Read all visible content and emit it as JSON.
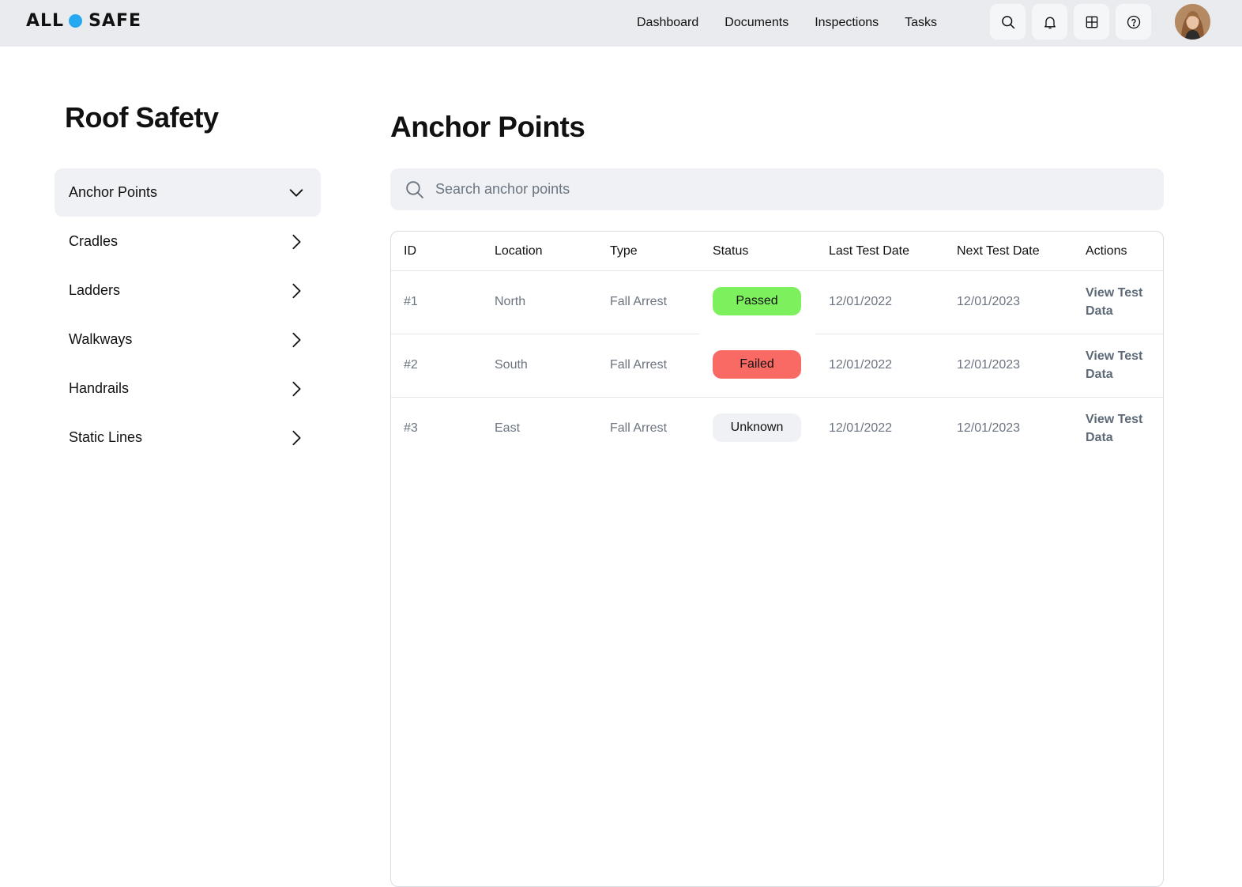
{
  "header": {
    "logo": {
      "left": "ALL",
      "right": "SAFE",
      "dot_color": "#27a9f1"
    },
    "nav": [
      "Dashboard",
      "Documents",
      "Inspections",
      "Tasks"
    ],
    "icons": [
      "search-icon",
      "bell-icon",
      "grid-icon",
      "help-icon"
    ]
  },
  "sidebar": {
    "title": "Roof Safety",
    "items": [
      {
        "label": "Anchor Points",
        "expanded": true
      },
      {
        "label": "Cradles",
        "expanded": false
      },
      {
        "label": "Ladders",
        "expanded": false
      },
      {
        "label": "Walkways",
        "expanded": false
      },
      {
        "label": "Handrails",
        "expanded": false
      },
      {
        "label": "Static Lines",
        "expanded": false
      }
    ]
  },
  "main": {
    "title": "Anchor Points",
    "search": {
      "placeholder": "Search anchor points",
      "value": ""
    },
    "table": {
      "columns": [
        "ID",
        "Location",
        "Type",
        "Status",
        "Last Test Date",
        "Next Test Date",
        "Actions"
      ],
      "rows": [
        {
          "id": "#1",
          "location": "North",
          "type": "Fall Arrest",
          "status": "Passed",
          "last": "12/01/2022",
          "next": "12/01/2023",
          "action": "View Test Data"
        },
        {
          "id": "#2",
          "location": "South",
          "type": "Fall Arrest",
          "status": "Failed",
          "last": "12/01/2022",
          "next": "12/01/2023",
          "action": "View Test Data"
        },
        {
          "id": "#3",
          "location": "East",
          "type": "Fall Arrest",
          "status": "Unknown",
          "last": "12/01/2022",
          "next": "12/01/2023",
          "action": "View Test Data"
        }
      ]
    },
    "status_colors": {
      "Passed": "#7cf15d",
      "Failed": "#fa6a64",
      "Unknown": "#eff1f4"
    }
  }
}
